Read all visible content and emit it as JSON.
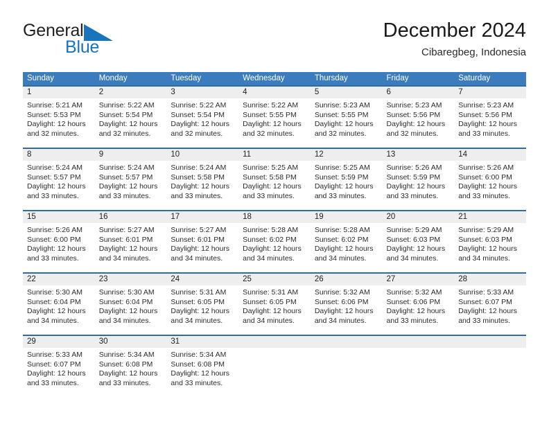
{
  "brand": {
    "name_part1": "General",
    "name_part2": "Blue",
    "triangle_color": "#1874bd",
    "text_color": "#231f20"
  },
  "header": {
    "title": "December 2024",
    "subtitle": "Cibaregbeg, Indonesia"
  },
  "theme": {
    "header_row_bg": "#3a7cbe",
    "row_divider": "#2e6da4",
    "daynum_band_bg": "#eeeeee",
    "page_bg": "#ffffff",
    "text": "#2b2b2b"
  },
  "weekdays": [
    "Sunday",
    "Monday",
    "Tuesday",
    "Wednesday",
    "Thursday",
    "Friday",
    "Saturday"
  ],
  "weeks": [
    [
      {
        "day": "1",
        "sunrise": "Sunrise: 5:21 AM",
        "sunset": "Sunset: 5:53 PM",
        "daylight_line1": "Daylight: 12 hours",
        "daylight_line2": "and 32 minutes."
      },
      {
        "day": "2",
        "sunrise": "Sunrise: 5:22 AM",
        "sunset": "Sunset: 5:54 PM",
        "daylight_line1": "Daylight: 12 hours",
        "daylight_line2": "and 32 minutes."
      },
      {
        "day": "3",
        "sunrise": "Sunrise: 5:22 AM",
        "sunset": "Sunset: 5:54 PM",
        "daylight_line1": "Daylight: 12 hours",
        "daylight_line2": "and 32 minutes."
      },
      {
        "day": "4",
        "sunrise": "Sunrise: 5:22 AM",
        "sunset": "Sunset: 5:55 PM",
        "daylight_line1": "Daylight: 12 hours",
        "daylight_line2": "and 32 minutes."
      },
      {
        "day": "5",
        "sunrise": "Sunrise: 5:23 AM",
        "sunset": "Sunset: 5:55 PM",
        "daylight_line1": "Daylight: 12 hours",
        "daylight_line2": "and 32 minutes."
      },
      {
        "day": "6",
        "sunrise": "Sunrise: 5:23 AM",
        "sunset": "Sunset: 5:56 PM",
        "daylight_line1": "Daylight: 12 hours",
        "daylight_line2": "and 32 minutes."
      },
      {
        "day": "7",
        "sunrise": "Sunrise: 5:23 AM",
        "sunset": "Sunset: 5:56 PM",
        "daylight_line1": "Daylight: 12 hours",
        "daylight_line2": "and 33 minutes."
      }
    ],
    [
      {
        "day": "8",
        "sunrise": "Sunrise: 5:24 AM",
        "sunset": "Sunset: 5:57 PM",
        "daylight_line1": "Daylight: 12 hours",
        "daylight_line2": "and 33 minutes."
      },
      {
        "day": "9",
        "sunrise": "Sunrise: 5:24 AM",
        "sunset": "Sunset: 5:57 PM",
        "daylight_line1": "Daylight: 12 hours",
        "daylight_line2": "and 33 minutes."
      },
      {
        "day": "10",
        "sunrise": "Sunrise: 5:24 AM",
        "sunset": "Sunset: 5:58 PM",
        "daylight_line1": "Daylight: 12 hours",
        "daylight_line2": "and 33 minutes."
      },
      {
        "day": "11",
        "sunrise": "Sunrise: 5:25 AM",
        "sunset": "Sunset: 5:58 PM",
        "daylight_line1": "Daylight: 12 hours",
        "daylight_line2": "and 33 minutes."
      },
      {
        "day": "12",
        "sunrise": "Sunrise: 5:25 AM",
        "sunset": "Sunset: 5:59 PM",
        "daylight_line1": "Daylight: 12 hours",
        "daylight_line2": "and 33 minutes."
      },
      {
        "day": "13",
        "sunrise": "Sunrise: 5:26 AM",
        "sunset": "Sunset: 5:59 PM",
        "daylight_line1": "Daylight: 12 hours",
        "daylight_line2": "and 33 minutes."
      },
      {
        "day": "14",
        "sunrise": "Sunrise: 5:26 AM",
        "sunset": "Sunset: 6:00 PM",
        "daylight_line1": "Daylight: 12 hours",
        "daylight_line2": "and 33 minutes."
      }
    ],
    [
      {
        "day": "15",
        "sunrise": "Sunrise: 5:26 AM",
        "sunset": "Sunset: 6:00 PM",
        "daylight_line1": "Daylight: 12 hours",
        "daylight_line2": "and 33 minutes."
      },
      {
        "day": "16",
        "sunrise": "Sunrise: 5:27 AM",
        "sunset": "Sunset: 6:01 PM",
        "daylight_line1": "Daylight: 12 hours",
        "daylight_line2": "and 34 minutes."
      },
      {
        "day": "17",
        "sunrise": "Sunrise: 5:27 AM",
        "sunset": "Sunset: 6:01 PM",
        "daylight_line1": "Daylight: 12 hours",
        "daylight_line2": "and 34 minutes."
      },
      {
        "day": "18",
        "sunrise": "Sunrise: 5:28 AM",
        "sunset": "Sunset: 6:02 PM",
        "daylight_line1": "Daylight: 12 hours",
        "daylight_line2": "and 34 minutes."
      },
      {
        "day": "19",
        "sunrise": "Sunrise: 5:28 AM",
        "sunset": "Sunset: 6:02 PM",
        "daylight_line1": "Daylight: 12 hours",
        "daylight_line2": "and 34 minutes."
      },
      {
        "day": "20",
        "sunrise": "Sunrise: 5:29 AM",
        "sunset": "Sunset: 6:03 PM",
        "daylight_line1": "Daylight: 12 hours",
        "daylight_line2": "and 34 minutes."
      },
      {
        "day": "21",
        "sunrise": "Sunrise: 5:29 AM",
        "sunset": "Sunset: 6:03 PM",
        "daylight_line1": "Daylight: 12 hours",
        "daylight_line2": "and 34 minutes."
      }
    ],
    [
      {
        "day": "22",
        "sunrise": "Sunrise: 5:30 AM",
        "sunset": "Sunset: 6:04 PM",
        "daylight_line1": "Daylight: 12 hours",
        "daylight_line2": "and 34 minutes."
      },
      {
        "day": "23",
        "sunrise": "Sunrise: 5:30 AM",
        "sunset": "Sunset: 6:04 PM",
        "daylight_line1": "Daylight: 12 hours",
        "daylight_line2": "and 34 minutes."
      },
      {
        "day": "24",
        "sunrise": "Sunrise: 5:31 AM",
        "sunset": "Sunset: 6:05 PM",
        "daylight_line1": "Daylight: 12 hours",
        "daylight_line2": "and 34 minutes."
      },
      {
        "day": "25",
        "sunrise": "Sunrise: 5:31 AM",
        "sunset": "Sunset: 6:05 PM",
        "daylight_line1": "Daylight: 12 hours",
        "daylight_line2": "and 34 minutes."
      },
      {
        "day": "26",
        "sunrise": "Sunrise: 5:32 AM",
        "sunset": "Sunset: 6:06 PM",
        "daylight_line1": "Daylight: 12 hours",
        "daylight_line2": "and 34 minutes."
      },
      {
        "day": "27",
        "sunrise": "Sunrise: 5:32 AM",
        "sunset": "Sunset: 6:06 PM",
        "daylight_line1": "Daylight: 12 hours",
        "daylight_line2": "and 33 minutes."
      },
      {
        "day": "28",
        "sunrise": "Sunrise: 5:33 AM",
        "sunset": "Sunset: 6:07 PM",
        "daylight_line1": "Daylight: 12 hours",
        "daylight_line2": "and 33 minutes."
      }
    ],
    [
      {
        "day": "29",
        "sunrise": "Sunrise: 5:33 AM",
        "sunset": "Sunset: 6:07 PM",
        "daylight_line1": "Daylight: 12 hours",
        "daylight_line2": "and 33 minutes."
      },
      {
        "day": "30",
        "sunrise": "Sunrise: 5:34 AM",
        "sunset": "Sunset: 6:08 PM",
        "daylight_line1": "Daylight: 12 hours",
        "daylight_line2": "and 33 minutes."
      },
      {
        "day": "31",
        "sunrise": "Sunrise: 5:34 AM",
        "sunset": "Sunset: 6:08 PM",
        "daylight_line1": "Daylight: 12 hours",
        "daylight_line2": "and 33 minutes."
      },
      {
        "day": "",
        "sunrise": "",
        "sunset": "",
        "daylight_line1": "",
        "daylight_line2": ""
      },
      {
        "day": "",
        "sunrise": "",
        "sunset": "",
        "daylight_line1": "",
        "daylight_line2": ""
      },
      {
        "day": "",
        "sunrise": "",
        "sunset": "",
        "daylight_line1": "",
        "daylight_line2": ""
      },
      {
        "day": "",
        "sunrise": "",
        "sunset": "",
        "daylight_line1": "",
        "daylight_line2": ""
      }
    ]
  ]
}
